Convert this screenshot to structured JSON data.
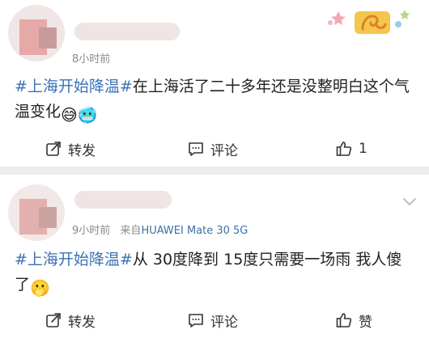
{
  "posts": [
    {
      "time": "8小时前",
      "source": "",
      "content": {
        "hashtag": "#上海开始降温#",
        "text": "在上海活了二十多年还是没整明白这个气温变化",
        "emojis": [
          "😅",
          "🥶"
        ]
      },
      "actions": {
        "share": "转发",
        "comment": "评论",
        "like": "1"
      }
    },
    {
      "time": "9小时前",
      "source_prefix": "来自",
      "source": "HUAWEI Mate 30 5G",
      "content": {
        "hashtag": "#上海开始降温#",
        "text": "从 30度降到 15度只需要一场雨 我人傻了",
        "emojis": [
          "🫢"
        ]
      },
      "actions": {
        "share": "转发",
        "comment": "评论",
        "like": "赞"
      }
    }
  ],
  "icons": {
    "share": "share-icon",
    "comment": "comment-icon",
    "like": "thumbs-up-icon",
    "more": "chevron-down-icon",
    "sticker": "leo-zodiac-sticker"
  },
  "colors": {
    "hashtag": "#3a71b4",
    "device": "#3c6fa8",
    "meta": "#8a8a8a"
  }
}
